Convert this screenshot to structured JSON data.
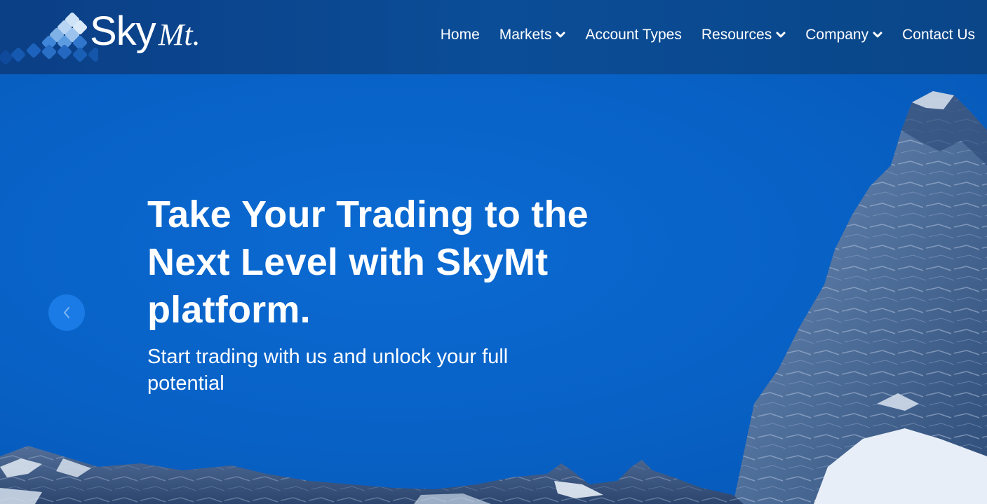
{
  "brand": {
    "name_part1": "Sky",
    "name_part2": "Mt."
  },
  "nav": {
    "items": [
      {
        "label": "Home",
        "has_dropdown": false
      },
      {
        "label": "Markets",
        "has_dropdown": true
      },
      {
        "label": "Account Types",
        "has_dropdown": false
      },
      {
        "label": "Resources",
        "has_dropdown": true
      },
      {
        "label": "Company",
        "has_dropdown": true
      },
      {
        "label": "Contact Us",
        "has_dropdown": false
      }
    ]
  },
  "hero": {
    "title": "Take Your Trading to the Next Level with SkyMt platform.",
    "subtitle": "Start trading with us and unlock your full potential",
    "prev_icon": "chevron-left-icon"
  },
  "colors": {
    "header_bg": "#0b4a92",
    "hero_bg": "#0a63c4",
    "accent": "#1a7be6",
    "text": "#ffffff"
  }
}
